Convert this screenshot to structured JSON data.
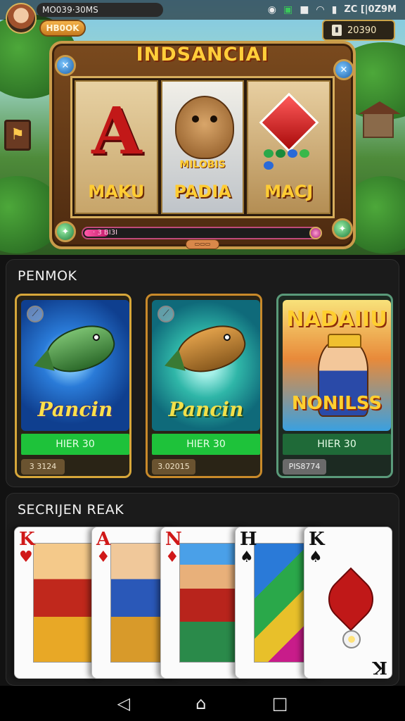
{
  "status_bar": {
    "title": "MO039·30MS",
    "time": "ZC [|0Z9M",
    "icons": [
      "notification-icon",
      "message-icon",
      "square-icon",
      "wifi-icon",
      "signal-icon"
    ]
  },
  "header": {
    "badge": "HB0OK",
    "balance": "20390"
  },
  "slot_machine": {
    "title": "INDSANCIAI",
    "reels": [
      {
        "symbol": "A",
        "label": "MAKU"
      },
      {
        "symbol": "goat",
        "sublabel": "MILOBIS",
        "label": "PADIA"
      },
      {
        "symbol": "diamond",
        "label": "MACJ"
      }
    ],
    "progress_text": "· 3 BI3I",
    "progress_fraction": 0.1,
    "button_label": "▭▭▭"
  },
  "fishing_section": {
    "title": "PENMOK",
    "cards": [
      {
        "title": "Pancin",
        "play_label": "HIER 30",
        "price": "3 3124"
      },
      {
        "title": "Pancin",
        "play_label": "HIER 30",
        "price": "3.02015"
      },
      {
        "title_top": "NADAIIU",
        "title_bottom": "NONILSS",
        "play_label": "HIER 30",
        "price": "PIS8774"
      }
    ]
  },
  "cards_section": {
    "title": "SECRIJEN REAK",
    "cards": [
      {
        "rank": "K",
        "suit": "♥"
      },
      {
        "rank": "A",
        "suit": "♦"
      },
      {
        "rank": "N",
        "suit": "♦"
      },
      {
        "rank": "H",
        "suit": "♠"
      },
      {
        "rank": "K",
        "suit": "♠"
      }
    ]
  },
  "nav": {
    "back": "◁",
    "home": "⌂",
    "recent": "□"
  },
  "colors": {
    "accent_gold": "#d7a73a",
    "play_green": "#1ec23a",
    "title_yellow": "#ffce3a"
  }
}
